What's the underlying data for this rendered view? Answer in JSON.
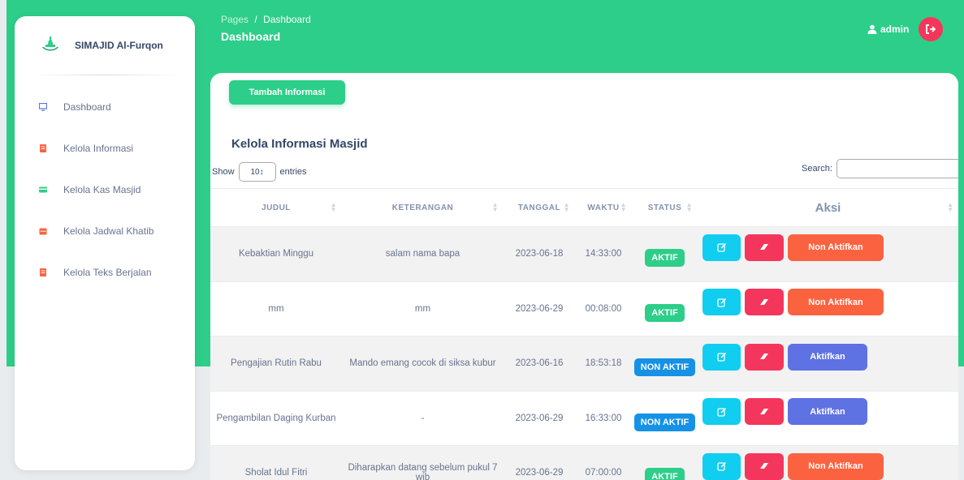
{
  "brand": {
    "name": "SIMAJID Al-Furqon"
  },
  "sidebar": {
    "items": [
      {
        "label": "Dashboard",
        "icon": "monitor-icon",
        "color": "#5e72e4"
      },
      {
        "label": "Kelola Informasi",
        "icon": "document-icon",
        "color": "#fb6340"
      },
      {
        "label": "Kelola Kas Masjid",
        "icon": "credit-card-icon",
        "color": "#2dce89"
      },
      {
        "label": "Kelola Jadwal Khatib",
        "icon": "calendar-icon",
        "color": "#fb6340"
      },
      {
        "label": "Kelola Teks Berjalan",
        "icon": "document-icon",
        "color": "#fb6340"
      }
    ]
  },
  "header": {
    "breadcrumb_root": "Pages",
    "breadcrumb_sep": "/",
    "breadcrumb_current": "Dashboard",
    "title": "Dashboard",
    "user": "admin"
  },
  "main": {
    "add_button": "Tambah Informasi",
    "card_title": "Kelola Informasi Masjid",
    "show_label": "Show",
    "entries_value": "10",
    "entries_label": "entries",
    "search_label": "Search:",
    "columns": [
      "JUDUL",
      "KETERANGAN",
      "TANGGAL",
      "WAKTU",
      "STATUS",
      "Aksi"
    ],
    "rows": [
      {
        "judul": "Kebaktian Minggu",
        "keterangan": "salam nama bapa",
        "tanggal": "2023-06-18",
        "waktu": "14:33:00",
        "status": "AKTIF",
        "toggle": "Non Aktifkan"
      },
      {
        "judul": "mm",
        "keterangan": "mm",
        "tanggal": "2023-06-29",
        "waktu": "00:08:00",
        "status": "AKTIF",
        "toggle": "Non Aktifkan"
      },
      {
        "judul": "Pengajian Rutin Rabu",
        "keterangan": "Mando emang cocok di siksa kubur",
        "tanggal": "2023-06-16",
        "waktu": "18:53:18",
        "status": "NON AKTIF",
        "toggle": "Aktifkan"
      },
      {
        "judul": "Pengambilan Daging Kurban",
        "keterangan": "-",
        "tanggal": "2023-06-29",
        "waktu": "16:33:00",
        "status": "NON AKTIF",
        "toggle": "Aktifkan"
      },
      {
        "judul": "Sholat Idul Fitri",
        "keterangan": "Diharapkan datang sebelum pukul 7 wib",
        "tanggal": "2023-06-29",
        "waktu": "07:00:00",
        "status": "AKTIF",
        "toggle": "Non Aktifkan"
      }
    ]
  },
  "colors": {
    "primary_green": "#2dce89",
    "edit": "#11cdef",
    "delete": "#f5365c",
    "deactivate": "#fb6340",
    "activate": "#5e72e4",
    "inactive_badge": "#1592e6"
  }
}
